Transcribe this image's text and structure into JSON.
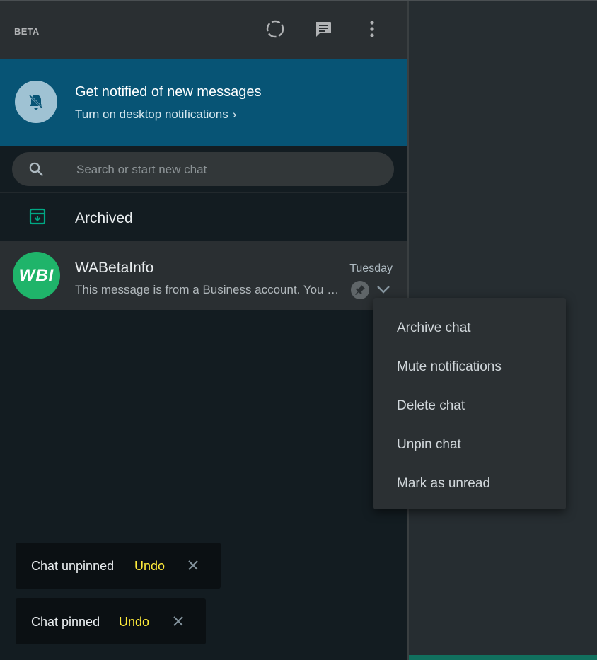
{
  "header": {
    "badge": "BETA",
    "icons": [
      "status-icon",
      "new-chat-icon",
      "menu-icon"
    ]
  },
  "notification": {
    "title": "Get notified of new messages",
    "subtitle": "Turn on desktop notifications",
    "subtitle_chevron": "›"
  },
  "search": {
    "placeholder": "Search or start new chat"
  },
  "archived": {
    "label": "Archived"
  },
  "chat": {
    "avatar_text": "WBI",
    "name": "WABetaInfo",
    "time": "Tuesday",
    "preview": "This message is from a Business account. You can now see the Business profile",
    "pinned": true
  },
  "context_menu": {
    "items": [
      "Archive chat",
      "Mute notifications",
      "Delete chat",
      "Unpin chat",
      "Mark as unread"
    ]
  },
  "toasts": [
    {
      "text": "Chat unpinned",
      "action": "Undo"
    },
    {
      "text": "Chat pinned",
      "action": "Undo"
    }
  ],
  "colors": {
    "panel_bg": "#131c21",
    "header_bg": "#2a2f32",
    "banner_bg": "#075475",
    "accent": "#00a884",
    "undo": "#ffeb3b"
  }
}
